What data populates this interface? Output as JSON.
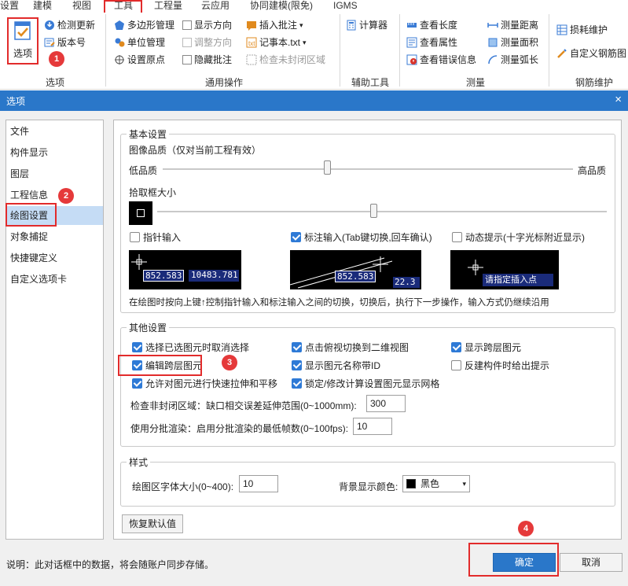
{
  "ribbon": {
    "tabs": [
      "设置",
      "建模",
      "视图",
      "工具",
      "工程量",
      "云应用",
      "协同建模(限免)",
      "IGMS"
    ],
    "options": {
      "big_label": "选项",
      "check_update": "检测更新",
      "version": "版本号",
      "group": "选项"
    },
    "general_ops": {
      "polygon_mgmt": "多边形管理",
      "show_direction": "显示方向",
      "insert_annotation": "插入批注",
      "unit_mgmt": "单位管理",
      "adjust_direction": "调整方向",
      "notepad": "记事本.txt",
      "set_origin": "设置原点",
      "hide_annotation": "隐藏批注",
      "check_unclosed": "检查未封闭区域",
      "group": "通用操作"
    },
    "aux_tools": {
      "calculator": "计算器",
      "group": "辅助工具"
    },
    "measure": {
      "view_length": "查看长度",
      "view_attr": "查看属性",
      "view_error": "查看错误信息",
      "measure_distance": "测量距离",
      "measure_area": "测量面积",
      "measure_arc": "测量弧长",
      "group": "测量"
    },
    "rebar": {
      "loss_maintain": "损耗维护",
      "custom_rebar": "自定义钢筋图",
      "group": "钢筋维护"
    }
  },
  "dialog": {
    "title": "选项",
    "close_icon": "×",
    "nav": [
      "文件",
      "构件显示",
      "图层",
      "工程信息",
      "绘图设置",
      "对象捕捉",
      "快捷键定义",
      "自定义选项卡"
    ],
    "selected_nav": "绘图设置",
    "basic": {
      "legend": "基本设置",
      "image_quality_label": "图像品质（仅对当前工程有效）",
      "low_quality": "低品质",
      "high_quality": "高品质",
      "image_quality_level": 0.4,
      "pick_box_label": "拾取框大小",
      "pick_box_level": 0.5,
      "pointer_input": {
        "label": "指针输入",
        "checked": false
      },
      "dimension_input": {
        "label": "标注输入(Tab键切换,回车确认)",
        "checked": true
      },
      "dynamic_hint": {
        "label": "动态提示(十字光标附近显示)",
        "checked": false
      },
      "preview1": {
        "v1": "852.583",
        "v2": "10483.781"
      },
      "preview2": {
        "v1": "852.583",
        "v2": "22.3"
      },
      "preview3": {
        "hint": "请指定插入点"
      },
      "note": "在绘图时按向上键↑控制指针输入和标注输入之间的切换，切换后，执行下一步操作，输入方式仍继续沿用"
    },
    "other": {
      "legend": "其他设置",
      "options": [
        {
          "label": "选择已选图元时取消选择",
          "checked": true
        },
        {
          "label": "点击俯视切换到二维视图",
          "checked": true
        },
        {
          "label": "显示跨层图元",
          "checked": true
        },
        {
          "label": "编辑跨层图元",
          "checked": true
        },
        {
          "label": "显示图元名称带ID",
          "checked": true
        },
        {
          "label": "反建构件时给出提示",
          "checked": false
        },
        {
          "label": "允许对图元进行快速拉伸和平移",
          "checked": true
        },
        {
          "label": "锁定/修改计算设置图元显示网格",
          "checked": true
        }
      ],
      "unclosed_label": "检查非封闭区域：缺口相交误差延伸范围(0~1000mm):",
      "unclosed_value": "300",
      "batch_label": "使用分批渲染：启用分批渲染的最低帧数(0~100fps):",
      "batch_value": "10"
    },
    "style": {
      "legend": "样式",
      "font_size_label": "绘图区字体大小(0~400):",
      "font_size_value": "10",
      "bg_color_label": "背景显示颜色:",
      "bg_color_value": "黑色",
      "bg_color_hex": "#000000"
    },
    "restore_default": "恢复默认值",
    "footer_note": "说明：此对话框中的数据，将会随账户同步存储。",
    "ok": "确定",
    "cancel": "取消"
  },
  "annotations": [
    "1",
    "2",
    "3",
    "4"
  ],
  "colors": {
    "accent": "#2a77c9",
    "highlight": "#e22b2b",
    "selection": "#c5dcf5"
  }
}
